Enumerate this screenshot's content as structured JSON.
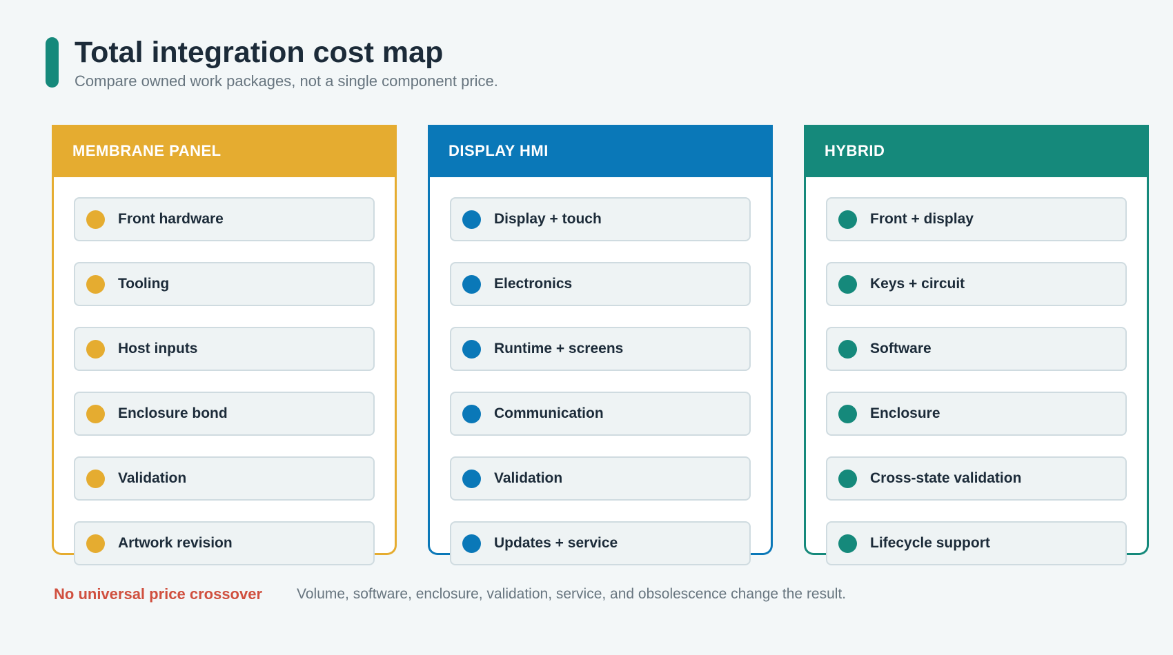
{
  "header": {
    "title": "Total integration cost map",
    "subtitle": "Compare owned work packages, not a single component price.",
    "accent_color": "#15897b"
  },
  "columns": [
    {
      "label": "MEMBRANE PANEL",
      "color": "#e5ac30",
      "items": [
        "Front hardware",
        "Tooling",
        "Host inputs",
        "Enclosure bond",
        "Validation",
        "Artwork revision"
      ]
    },
    {
      "label": "DISPLAY HMI",
      "color": "#0a78b8",
      "items": [
        "Display + touch",
        "Electronics",
        "Runtime + screens",
        "Communication",
        "Validation",
        "Updates + service"
      ]
    },
    {
      "label": "HYBRID",
      "color": "#15897b",
      "items": [
        "Front + display",
        "Keys + circuit",
        "Software",
        "Enclosure",
        "Cross-state validation",
        "Lifecycle support"
      ]
    }
  ],
  "footer": {
    "warning": "No universal price crossover",
    "warning_color": "#d0503f",
    "note": "Volume, software, enclosure, validation, service, and obsolescence change the result."
  }
}
